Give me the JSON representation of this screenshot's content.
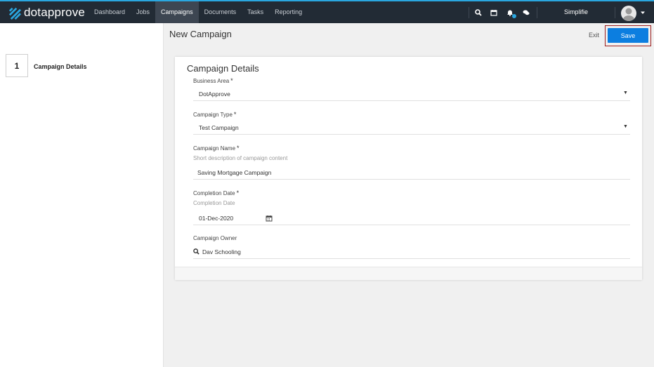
{
  "app": {
    "brand": "dotapprove",
    "accent": "#2aa7e0",
    "nav_bg": "#222b35",
    "primary": "#0c7ee0"
  },
  "nav": {
    "items": [
      {
        "label": "Dashboard",
        "active": false
      },
      {
        "label": "Jobs",
        "active": false
      },
      {
        "label": "Campaigns",
        "active": true
      },
      {
        "label": "Documents",
        "active": false
      },
      {
        "label": "Tasks",
        "active": false
      },
      {
        "label": "Reporting",
        "active": false
      }
    ],
    "icons": [
      "search-icon",
      "calendar-icon",
      "bell-icon",
      "chat-icon"
    ],
    "org": "Simplifie"
  },
  "steps": [
    {
      "number": "1",
      "label": "Campaign Details"
    }
  ],
  "page": {
    "title": "New Campaign",
    "exit_label": "Exit",
    "save_label": "Save"
  },
  "form": {
    "title": "Campaign Details",
    "business_area": {
      "label": "Business Area",
      "required": "*",
      "value": "DotApprove"
    },
    "campaign_type": {
      "label": "Campaign Type",
      "required": "*",
      "value": "Test Campaign"
    },
    "campaign_name": {
      "label": "Campaign Name",
      "required": "*",
      "hint": "Short description of campaign content",
      "value": "Saving Mortgage Campaign"
    },
    "completion_date": {
      "label": "Completion Date",
      "required": "*",
      "hint": "Completion Date",
      "value": "01-Dec-2020"
    },
    "campaign_owner": {
      "label": "Campaign Owner",
      "value": "Dav Schooling"
    }
  }
}
